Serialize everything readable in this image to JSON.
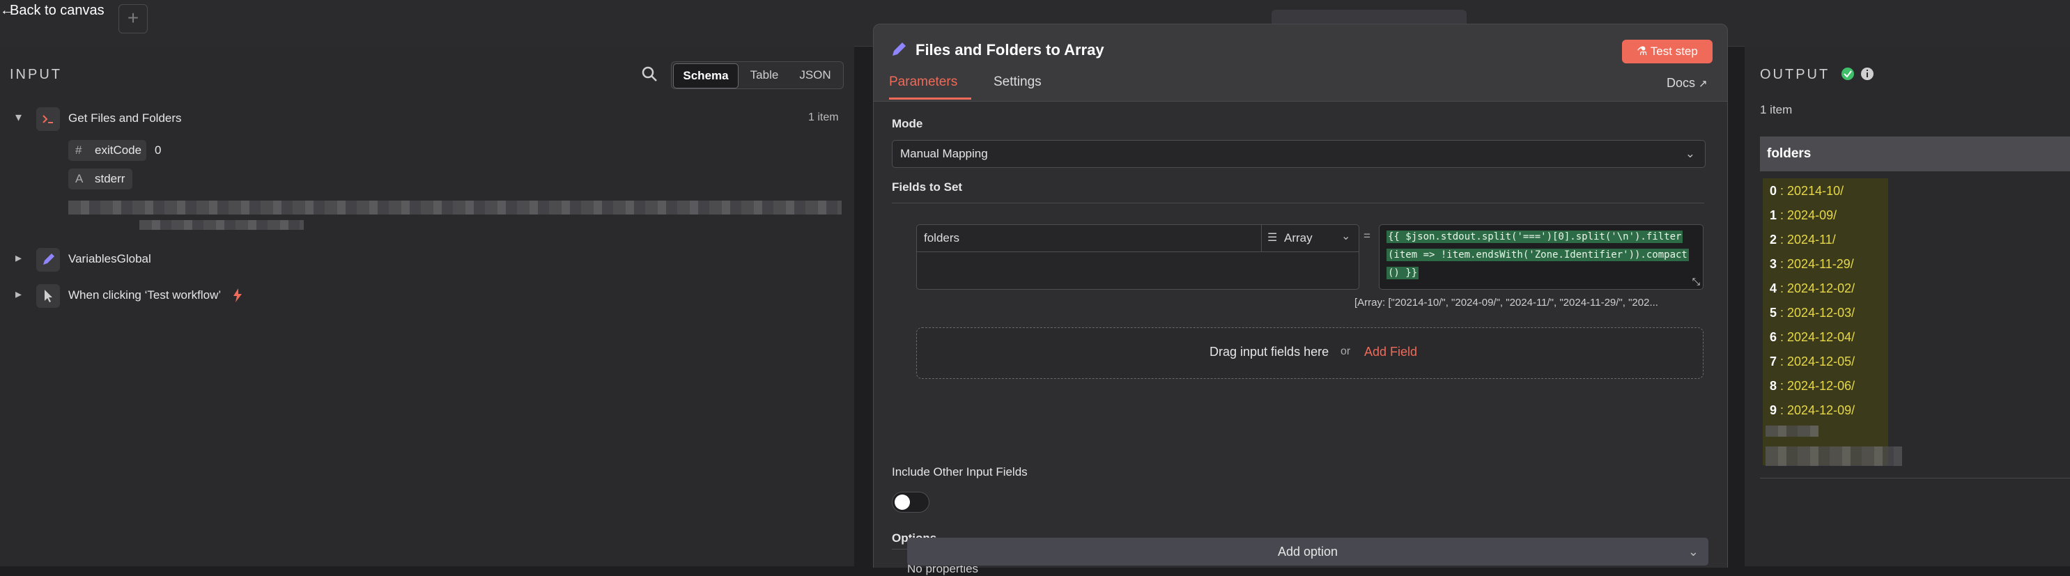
{
  "topbar": {
    "back_label": "Back to canvas",
    "back_arrow": "←",
    "add_tab": "+"
  },
  "input": {
    "title": "INPUT",
    "view_tabs": [
      "Schema",
      "Table",
      "JSON"
    ],
    "active_view": "Schema",
    "nodes": [
      {
        "label": "Get Files and Folders",
        "count": "1 item",
        "icon": "terminal-icon"
      },
      {
        "label": "VariablesGlobal",
        "icon": "pencil-icon"
      },
      {
        "label": "When clicking ‘Test workflow’",
        "icon": "cursor-icon"
      }
    ],
    "fields": [
      {
        "type": "#",
        "name": "exitCode",
        "value": "0"
      },
      {
        "type": "A",
        "name": "stderr",
        "value": ""
      }
    ]
  },
  "node": {
    "title": "Files and Folders to Array",
    "test_label": "Test step",
    "tabs": [
      "Parameters",
      "Settings"
    ],
    "docs_label": "Docs",
    "mode_label": "Mode",
    "mode_value": "Manual Mapping",
    "fields_label": "Fields to Set",
    "field_name": "folders",
    "field_type": "Array",
    "equals": "=",
    "expression_lines": [
      "{{ $json.stdout.split('===')[0].split('\\n').filter",
      "(item => !item.endsWith('Zone.Identifier')).compact",
      "() }}"
    ],
    "expression_result": "[Array: [\"20214-10/\", \"2024-09/\", \"2024-11/\", \"2024-11-29/\", \"202...",
    "drop_text": "Drag input fields here",
    "drop_or": "or",
    "add_field": "Add Field",
    "include_label": "Include Other Input Fields",
    "options_label": "Options",
    "no_properties": "No properties",
    "add_option": "Add option"
  },
  "output": {
    "title": "OUTPUT",
    "count": "1 item",
    "column": "folders",
    "items": [
      {
        "index": "0",
        "value": "20214-10/"
      },
      {
        "index": "1",
        "value": "2024-09/"
      },
      {
        "index": "2",
        "value": "2024-11/"
      },
      {
        "index": "3",
        "value": "2024-11-29/"
      },
      {
        "index": "4",
        "value": "2024-12-02/"
      },
      {
        "index": "5",
        "value": "2024-12-03/"
      },
      {
        "index": "6",
        "value": "2024-12-04/"
      },
      {
        "index": "7",
        "value": "2024-12-05/"
      },
      {
        "index": "8",
        "value": "2024-12-06/"
      },
      {
        "index": "9",
        "value": "2024-12-09/"
      }
    ]
  },
  "colors": {
    "accent": "#ef6a59",
    "success": "#3fbf6a",
    "highlight": "#e6d84a"
  }
}
